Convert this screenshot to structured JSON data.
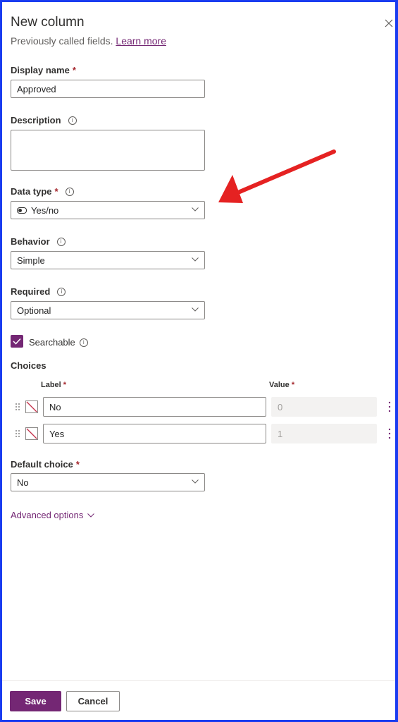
{
  "header": {
    "title": "New column",
    "subtitle": "Previously called fields.",
    "learn_more": "Learn more"
  },
  "fields": {
    "display_name": {
      "label": "Display name",
      "required_mark": "*",
      "value": "Approved"
    },
    "description": {
      "label": "Description",
      "value": ""
    },
    "data_type": {
      "label": "Data type",
      "required_mark": "*",
      "value": "Yes/no",
      "icon": "toggle-icon"
    },
    "behavior": {
      "label": "Behavior",
      "value": "Simple"
    },
    "required": {
      "label": "Required",
      "value": "Optional"
    },
    "searchable": {
      "label": "Searchable",
      "checked": true
    },
    "choices": {
      "label": "Choices",
      "label_header": "Label",
      "value_header": "Value",
      "required_mark": "*",
      "items": [
        {
          "label": "No",
          "value": "0"
        },
        {
          "label": "Yes",
          "value": "1"
        }
      ]
    },
    "default_choice": {
      "label": "Default choice",
      "required_mark": "*",
      "value": "No"
    }
  },
  "advanced_options": "Advanced options",
  "footer": {
    "save": "Save",
    "cancel": "Cancel"
  },
  "colors": {
    "accent": "#742774",
    "required": "#a4262c",
    "annotation_arrow": "#e52222",
    "frame": "#1a3cf0"
  }
}
